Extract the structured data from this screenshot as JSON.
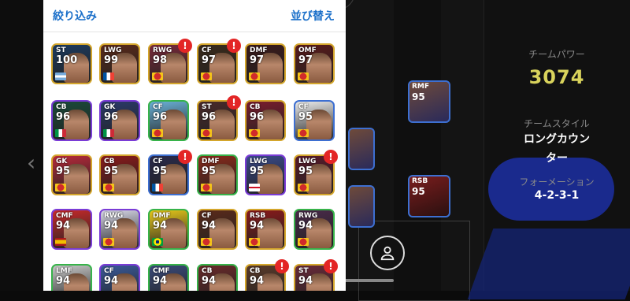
{
  "header": {
    "filter_label": "絞り込み",
    "sort_label": "並び替え"
  },
  "team": {
    "power_label": "チームパワー",
    "power_value": "3074",
    "style_label": "チームスタイル",
    "style_value_line1": "ロングカウン",
    "style_value_line2": "ター",
    "formation_label": "フォーメーション",
    "formation_value": "4-2-3-1"
  },
  "field_players": [
    {
      "position": "RMF",
      "rating": "95"
    },
    {
      "position": "RSB",
      "rating": "95"
    }
  ],
  "colors": {
    "accent_blue": "#1a6fc9",
    "badge_red": "#e32626",
    "power_yellow": "#d9d35c"
  },
  "cards": [
    {
      "position": "ST",
      "rating": "100",
      "alert": false,
      "flag": "argentina"
    },
    {
      "position": "LWG",
      "rating": "99",
      "alert": false,
      "flag": "france"
    },
    {
      "position": "RWG",
      "rating": "98",
      "alert": true,
      "flag": "club"
    },
    {
      "position": "CF",
      "rating": "97",
      "alert": true,
      "flag": "club"
    },
    {
      "position": "DMF",
      "rating": "97",
      "alert": false,
      "flag": "club"
    },
    {
      "position": "OMF",
      "rating": "97",
      "alert": false,
      "flag": "club"
    },
    {
      "position": "CB",
      "rating": "96",
      "alert": false,
      "flag": "italy"
    },
    {
      "position": "GK",
      "rating": "96",
      "alert": false,
      "flag": "italy"
    },
    {
      "position": "CF",
      "rating": "96",
      "alert": false,
      "flag": "club"
    },
    {
      "position": "ST",
      "rating": "96",
      "alert": true,
      "flag": "club"
    },
    {
      "position": "CB",
      "rating": "96",
      "alert": false,
      "flag": "club"
    },
    {
      "position": "CF",
      "rating": "95",
      "alert": false,
      "flag": "club"
    },
    {
      "position": "GK",
      "rating": "95",
      "alert": false,
      "flag": "club"
    },
    {
      "position": "CB",
      "rating": "95",
      "alert": false,
      "flag": "club"
    },
    {
      "position": "CF",
      "rating": "95",
      "alert": true,
      "flag": "france"
    },
    {
      "position": "DMF",
      "rating": "95",
      "alert": false,
      "flag": "club"
    },
    {
      "position": "LWG",
      "rating": "95",
      "alert": false,
      "flag": "england"
    },
    {
      "position": "LWG",
      "rating": "95",
      "alert": true,
      "flag": "club"
    },
    {
      "position": "CMF",
      "rating": "94",
      "alert": false,
      "flag": "spain"
    },
    {
      "position": "RWG",
      "rating": "94",
      "alert": false,
      "flag": "club"
    },
    {
      "position": "DMF",
      "rating": "94",
      "alert": false,
      "flag": "brazil"
    },
    {
      "position": "CF",
      "rating": "94",
      "alert": false,
      "flag": "club"
    },
    {
      "position": "RSB",
      "rating": "94",
      "alert": false,
      "flag": "club"
    },
    {
      "position": "RWG",
      "rating": "94",
      "alert": false,
      "flag": "club"
    },
    {
      "position": "LMF",
      "rating": "94",
      "alert": false,
      "flag": "club"
    },
    {
      "position": "CF",
      "rating": "94",
      "alert": false,
      "flag": "club"
    },
    {
      "position": "CMF",
      "rating": "94",
      "alert": false,
      "flag": "club"
    },
    {
      "position": "CB",
      "rating": "94",
      "alert": false,
      "flag": "club"
    },
    {
      "position": "CB",
      "rating": "94",
      "alert": true,
      "flag": "club"
    },
    {
      "position": "ST",
      "rating": "94",
      "alert": true,
      "flag": "club"
    }
  ]
}
